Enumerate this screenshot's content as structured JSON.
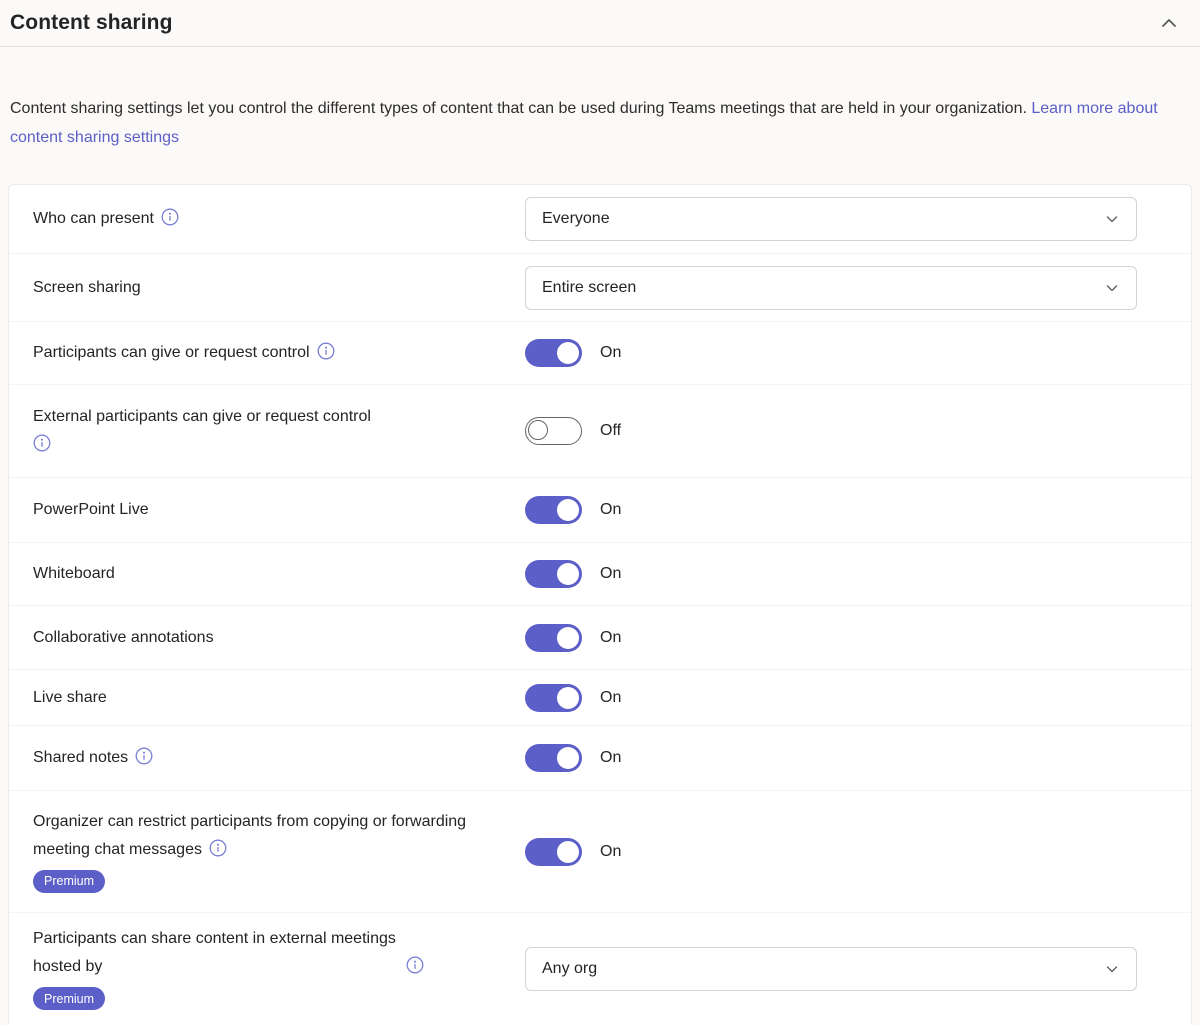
{
  "header": {
    "title": "Content sharing"
  },
  "description": {
    "text": "Content sharing settings let you control the different types of content that can be used during Teams meetings that are held in your organization.",
    "link_text": "Learn more about content sharing settings"
  },
  "rows": [
    {
      "label": "Who can present",
      "control": "dropdown",
      "value": "Everyone"
    },
    {
      "label": "Screen sharing",
      "control": "dropdown",
      "value": "Entire screen"
    },
    {
      "label": "Participants can give or request control",
      "control": "toggle",
      "state": "On"
    },
    {
      "label": "External participants can give or request control",
      "control": "toggle",
      "state": "Off"
    },
    {
      "label": "PowerPoint Live",
      "control": "toggle",
      "state": "On"
    },
    {
      "label": "Whiteboard",
      "control": "toggle",
      "state": "On"
    },
    {
      "label": "Collaborative annotations",
      "control": "toggle",
      "state": "On"
    },
    {
      "label": "Live share",
      "control": "toggle",
      "state": "On"
    },
    {
      "label": "Shared notes",
      "control": "toggle",
      "state": "On"
    },
    {
      "label": "Organizer can restrict participants from copying or forwarding meeting chat messages",
      "control": "toggle",
      "state": "On",
      "badge": "Premium"
    },
    {
      "label": "Participants can share content in external meetings hosted by",
      "control": "dropdown",
      "value": "Any org",
      "badge": "Premium"
    }
  ],
  "colors": {
    "accent": "#5b5fc7",
    "link": "#5b5fc7",
    "info_icon": "#7b80d5",
    "text": "#242424",
    "toggle_off_border": "#666564",
    "panel_border": "#ebebeb"
  }
}
